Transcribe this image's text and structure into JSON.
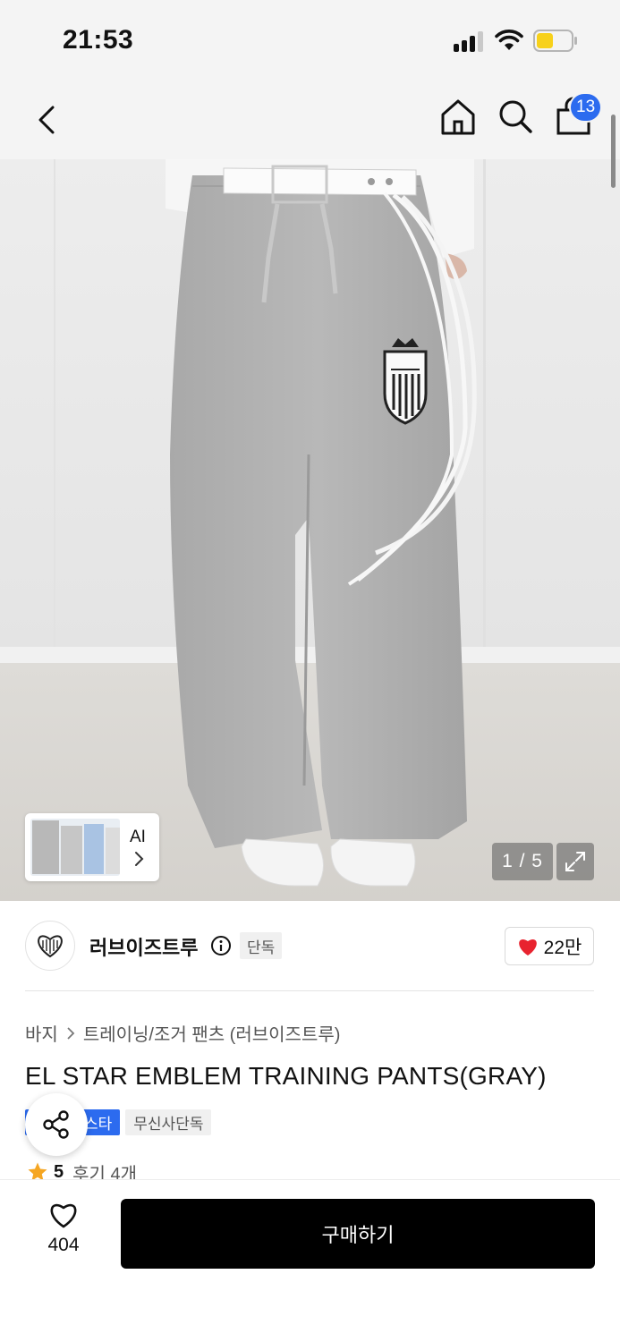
{
  "status_bar": {
    "time": "21:53"
  },
  "nav": {
    "back_icon": "chevron-left-icon",
    "home_icon": "home-icon",
    "search_icon": "search-icon",
    "bag_icon": "shopping-bag-icon",
    "bag_count": "13"
  },
  "gallery": {
    "ai_label": "AI",
    "counter": "1 / 5",
    "expand_icon": "expand-icon"
  },
  "brand": {
    "name": "러브이즈트루",
    "exclusive_tag": "단독",
    "like_count": "22만"
  },
  "breadcrumb": {
    "category": "바지",
    "subcategory": "트레이닝/조거 팬츠 (러브이즈트루)"
  },
  "product": {
    "title": "EL STAR EMBLEM TRAINING PANTS(GRAY)",
    "tag_blue": "스타",
    "tag_gray": "무신사단독",
    "rating": "5",
    "review_label": "후기 4개"
  },
  "bottom": {
    "wish_count": "404",
    "buy_label": "구매하기"
  },
  "colors": {
    "accent_blue": "#2c6bef",
    "like_red": "#e8232f",
    "star_orange": "#f5a623",
    "buy_black": "#000000"
  }
}
